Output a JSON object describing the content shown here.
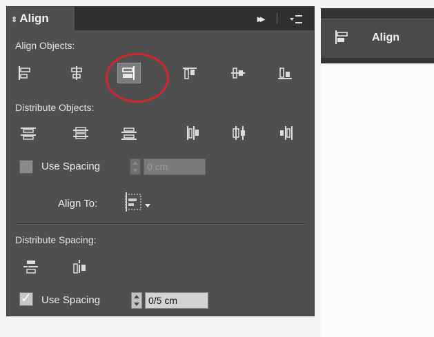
{
  "panel": {
    "tab_title": "Align",
    "tab_icon": "updown-chevron-icon",
    "collapse_icon": "double-arrow-right-icon",
    "menu_icon": "panel-menu-icon"
  },
  "align_objects": {
    "label": "Align Objects:",
    "buttons": [
      {
        "name": "align-left-edges",
        "icon": "align-left-icon",
        "selected": false
      },
      {
        "name": "align-horizontal-centers",
        "icon": "align-hcenter-icon",
        "selected": false
      },
      {
        "name": "align-right-edges",
        "icon": "align-right-icon",
        "selected": true
      },
      {
        "name": "align-top-edges",
        "icon": "align-top-icon",
        "selected": false
      },
      {
        "name": "align-vertical-centers",
        "icon": "align-vcenter-icon",
        "selected": false
      },
      {
        "name": "align-bottom-edges",
        "icon": "align-bottom-icon",
        "selected": false
      }
    ]
  },
  "distribute_objects": {
    "label": "Distribute Objects:",
    "use_spacing_label": "Use Spacing",
    "use_spacing_checked": false,
    "spacing_value": "0 cm"
  },
  "align_to": {
    "label": "Align To:",
    "icon": "align-to-selection-icon"
  },
  "distribute_spacing": {
    "label": "Distribute Spacing:",
    "use_spacing_label": "Use Spacing",
    "use_spacing_checked": true,
    "spacing_value": "0/5 cm"
  },
  "dock_button": {
    "label": "Align",
    "icon": "align-panel-icon"
  },
  "colors": {
    "panel_bg": "#4f4f4f",
    "titlebar_bg": "#2f2f2f",
    "highlight_ring": "#d7252b"
  }
}
